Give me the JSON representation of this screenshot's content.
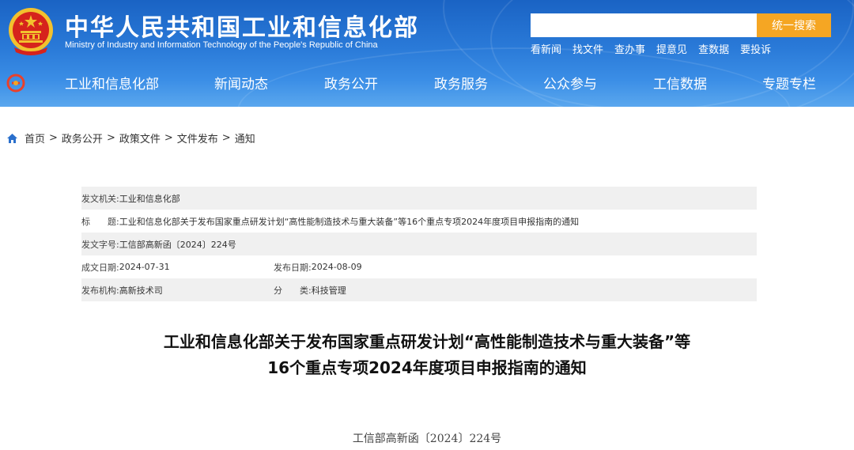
{
  "header": {
    "title_cn": "中华人民共和国工业和信息化部",
    "title_en": "Ministry of Industry and Information Technology of the People's Republic of China",
    "search_placeholder": "",
    "search_button": "统一搜索",
    "quick_links": [
      "看新闻",
      "找文件",
      "查办事",
      "提意见",
      "查数据",
      "要投诉"
    ],
    "colors": {
      "header_blue": "#2a7ad8",
      "search_orange": "#f5a623",
      "emblem_red": "#d6231c",
      "emblem_gold": "#f2c12e"
    }
  },
  "nav": {
    "logo_icon": "ministry-logo-icon",
    "items": [
      "工业和信息化部",
      "新闻动态",
      "政务公开",
      "政务服务",
      "公众参与",
      "工信数据",
      "专题专栏"
    ]
  },
  "breadcrumb": {
    "icon": "home-icon",
    "items": [
      "首页",
      "政务公开",
      "政策文件",
      "文件发布",
      "通知"
    ],
    "separator": ">"
  },
  "meta": {
    "issuer_label": "发文机关:",
    "issuer": "工业和信息化部",
    "subject_label": "标　　题:",
    "subject": "工业和信息化部关于发布国家重点研发计划“高性能制造技术与重大装备”等16个重点专项2024年度项目申报指南的通知",
    "doc_no_label": "发文字号:",
    "doc_no": "工信部高新函〔2024〕224号",
    "written_label": "成文日期:",
    "written_date": "2024-07-31",
    "published_label": "发布日期:",
    "published_date": "2024-08-09",
    "agency_label": "发布机构:",
    "agency": "高新技术司",
    "category_label": "分　　类:",
    "category": "科技管理"
  },
  "document": {
    "title_line1": "工业和信息化部关于发布国家重点研发计划“高性能制造技术与重大装备”等",
    "title_line2": "16个重点专项2024年度项目申报指南的通知",
    "doc_number": "工信部高新函〔2024〕224号"
  }
}
